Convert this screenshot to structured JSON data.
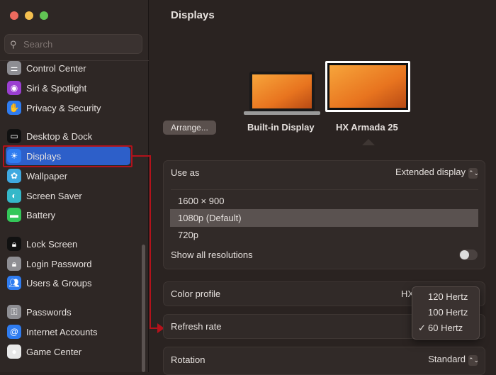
{
  "window": {
    "controls": [
      "close",
      "minimize",
      "zoom"
    ]
  },
  "search": {
    "placeholder": "Search"
  },
  "sidebar": {
    "items": [
      {
        "label": "Control Center",
        "icon": "control-center-icon",
        "color": "#8e8e93"
      },
      {
        "label": "Siri & Spotlight",
        "icon": "siri-icon",
        "color": "#9b3fd1"
      },
      {
        "label": "Privacy & Security",
        "icon": "hand-icon",
        "color": "#2f7cf0"
      },
      {
        "label": "Desktop & Dock",
        "icon": "dock-icon",
        "color": "#111111"
      },
      {
        "label": "Displays",
        "icon": "sun-icon",
        "color": "#2f7cf0"
      },
      {
        "label": "Wallpaper",
        "icon": "flower-icon",
        "color": "#3fa9e0"
      },
      {
        "label": "Screen Saver",
        "icon": "screen-saver-icon",
        "color": "#35b8c9"
      },
      {
        "label": "Battery",
        "icon": "battery-icon",
        "color": "#34c759"
      },
      {
        "label": "Lock Screen",
        "icon": "lock-icon",
        "color": "#111111"
      },
      {
        "label": "Login Password",
        "icon": "lock-icon",
        "color": "#8e8e93"
      },
      {
        "label": "Users & Groups",
        "icon": "users-icon",
        "color": "#2f7cf0"
      },
      {
        "label": "Passwords",
        "icon": "key-icon",
        "color": "#8e8e93"
      },
      {
        "label": "Internet Accounts",
        "icon": "at-icon",
        "color": "#2f7cf0"
      },
      {
        "label": "Game Center",
        "icon": "game-center-icon",
        "color": "#e8e8e8"
      }
    ]
  },
  "main": {
    "title": "Displays",
    "arrange": "Arrange...",
    "displays": [
      "Built-in Display",
      "HX Armada 25"
    ],
    "use_as": {
      "label": "Use as",
      "value": "Extended display"
    },
    "resolutions": [
      "1600 × 900",
      "1080p (Default)",
      "720p"
    ],
    "show_all": {
      "label": "Show all resolutions",
      "on": false
    },
    "color_profile": {
      "label": "Color profile",
      "value": "HX"
    },
    "refresh_rate": {
      "label": "Refresh rate",
      "options": [
        "120 Hertz",
        "100 Hertz",
        "60 Hertz"
      ],
      "selected": "60 Hertz",
      "check": "✓"
    },
    "rotation": {
      "label": "Rotation",
      "value": "Standard"
    }
  },
  "colors": {
    "accent": "#2d5fc9",
    "annotation": "#b3121b"
  }
}
